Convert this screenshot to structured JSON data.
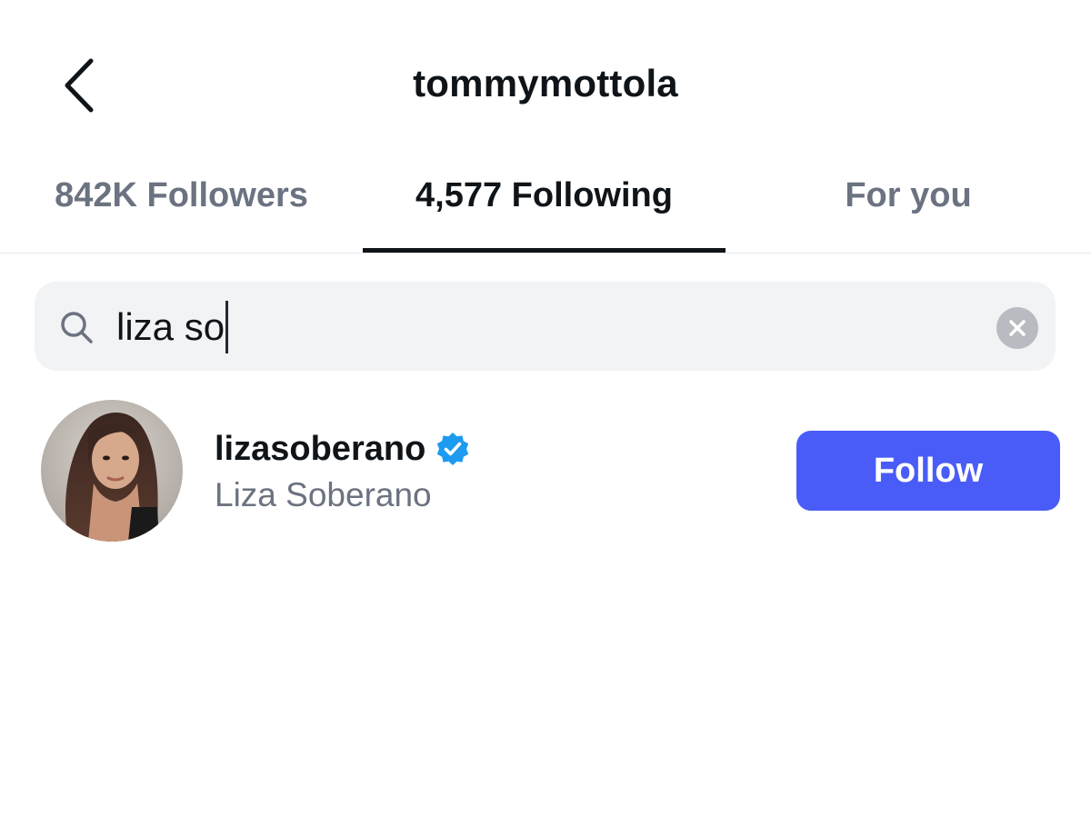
{
  "header": {
    "title": "tommymottola",
    "back_icon": "chevron-left-icon"
  },
  "tabs": [
    {
      "label": "842K Followers",
      "active": false
    },
    {
      "label": "4,577 Following",
      "active": true
    },
    {
      "label": "For you",
      "active": false
    }
  ],
  "search": {
    "value": "liza so",
    "icon": "search-icon",
    "clear_icon": "clear-icon"
  },
  "results": [
    {
      "username": "lizasoberano",
      "full_name": "Liza Soberano",
      "verified": true,
      "button_label": "Follow"
    }
  ],
  "colors": {
    "accent": "#4a5cf7",
    "verified": "#1d9bf0",
    "secondary_text": "#6b7280",
    "primary_text": "#0f1419"
  }
}
